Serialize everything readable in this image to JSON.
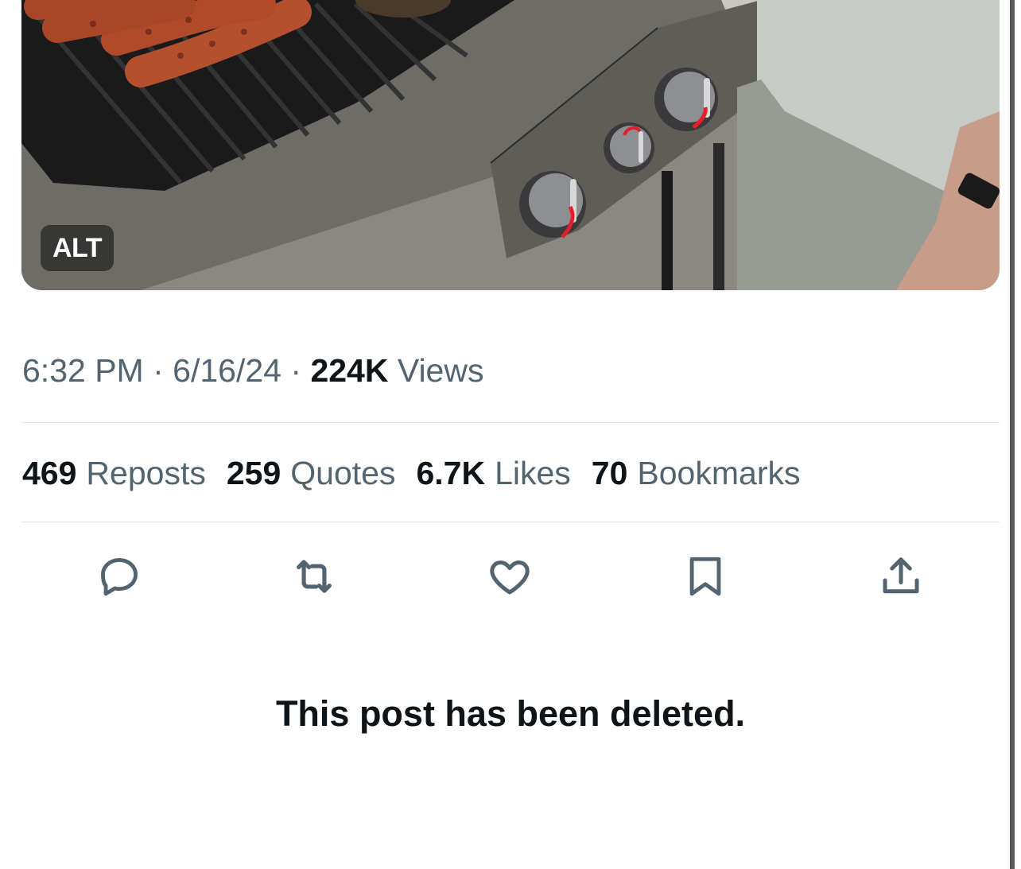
{
  "media": {
    "alt_label": "ALT"
  },
  "meta": {
    "time": "6:32 PM",
    "sep1": "·",
    "date": "6/16/24",
    "sep2": "·",
    "views_count": "224K",
    "views_label": " Views"
  },
  "stats": [
    {
      "count": "469",
      "label": "Reposts"
    },
    {
      "count": "259",
      "label": "Quotes"
    },
    {
      "count": "6.7K",
      "label": "Likes"
    },
    {
      "count": "70",
      "label": "Bookmarks"
    }
  ],
  "actions": [
    {
      "name": "reply",
      "icon": "reply-icon"
    },
    {
      "name": "repost",
      "icon": "repost-icon"
    },
    {
      "name": "like",
      "icon": "heart-icon"
    },
    {
      "name": "bookmark",
      "icon": "bookmark-icon"
    },
    {
      "name": "share",
      "icon": "share-icon"
    }
  ],
  "notice": "This post has been deleted.",
  "colors": {
    "text_primary": "#0f1419",
    "text_secondary": "#536471",
    "divider": "#e1e5e8",
    "knob_indicator": "#e0202a"
  }
}
